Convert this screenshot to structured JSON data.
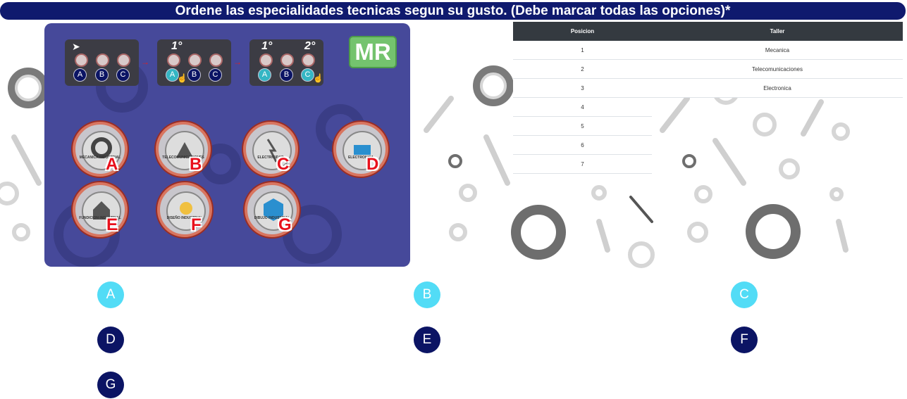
{
  "header": {
    "title": "Ordene las especialidades tecnicas segun su gusto. (Debe marcar todas las opciones)*"
  },
  "instructions_panel": {
    "logo_text": "MR",
    "step1": {
      "letters": [
        "A",
        "B",
        "C"
      ]
    },
    "step2": {
      "ranks": [
        "1°"
      ],
      "letters": [
        "A",
        "B",
        "C"
      ]
    },
    "step3": {
      "ranks": [
        "1°",
        "2°"
      ],
      "letters": [
        "A",
        "B",
        "C"
      ]
    },
    "badges": [
      {
        "letter": "A",
        "caption": "MECANICA INDUSTRIAL"
      },
      {
        "letter": "B",
        "caption": "TELECOMUNICACIONES"
      },
      {
        "letter": "C",
        "caption": "ELECTRICIDAD"
      },
      {
        "letter": "D",
        "caption": "ELECTRONICA"
      },
      {
        "letter": "E",
        "caption": "FUNDICION INDUSTRIAL"
      },
      {
        "letter": "F",
        "caption": "DISEÑO INDUSTRIAL"
      },
      {
        "letter": "G",
        "caption": "DIBUJO INDUSTRIAL"
      }
    ]
  },
  "ranking_table": {
    "headers": [
      "Posicion",
      "Taller"
    ],
    "rows": [
      {
        "pos": "1",
        "taller": "Mecanica"
      },
      {
        "pos": "2",
        "taller": "Telecomunicaciones"
      },
      {
        "pos": "3",
        "taller": "Electronica"
      },
      {
        "pos": "4",
        "taller": ""
      },
      {
        "pos": "5",
        "taller": ""
      },
      {
        "pos": "6",
        "taller": ""
      },
      {
        "pos": "7",
        "taller": ""
      }
    ]
  },
  "options": [
    {
      "label": "A",
      "state": "selected"
    },
    {
      "label": "B",
      "state": "selected"
    },
    {
      "label": "C",
      "state": "selected"
    },
    {
      "label": "D",
      "state": "unselected"
    },
    {
      "label": "E",
      "state": "unselected"
    },
    {
      "label": "F",
      "state": "unselected"
    },
    {
      "label": "G",
      "state": "unselected"
    }
  ],
  "colors": {
    "title_bar": "#0f1a6e",
    "option_selected": "#52dcf6",
    "option_unselected": "#0b1464",
    "panel_bg": "#46499a",
    "table_header": "#343a40"
  }
}
